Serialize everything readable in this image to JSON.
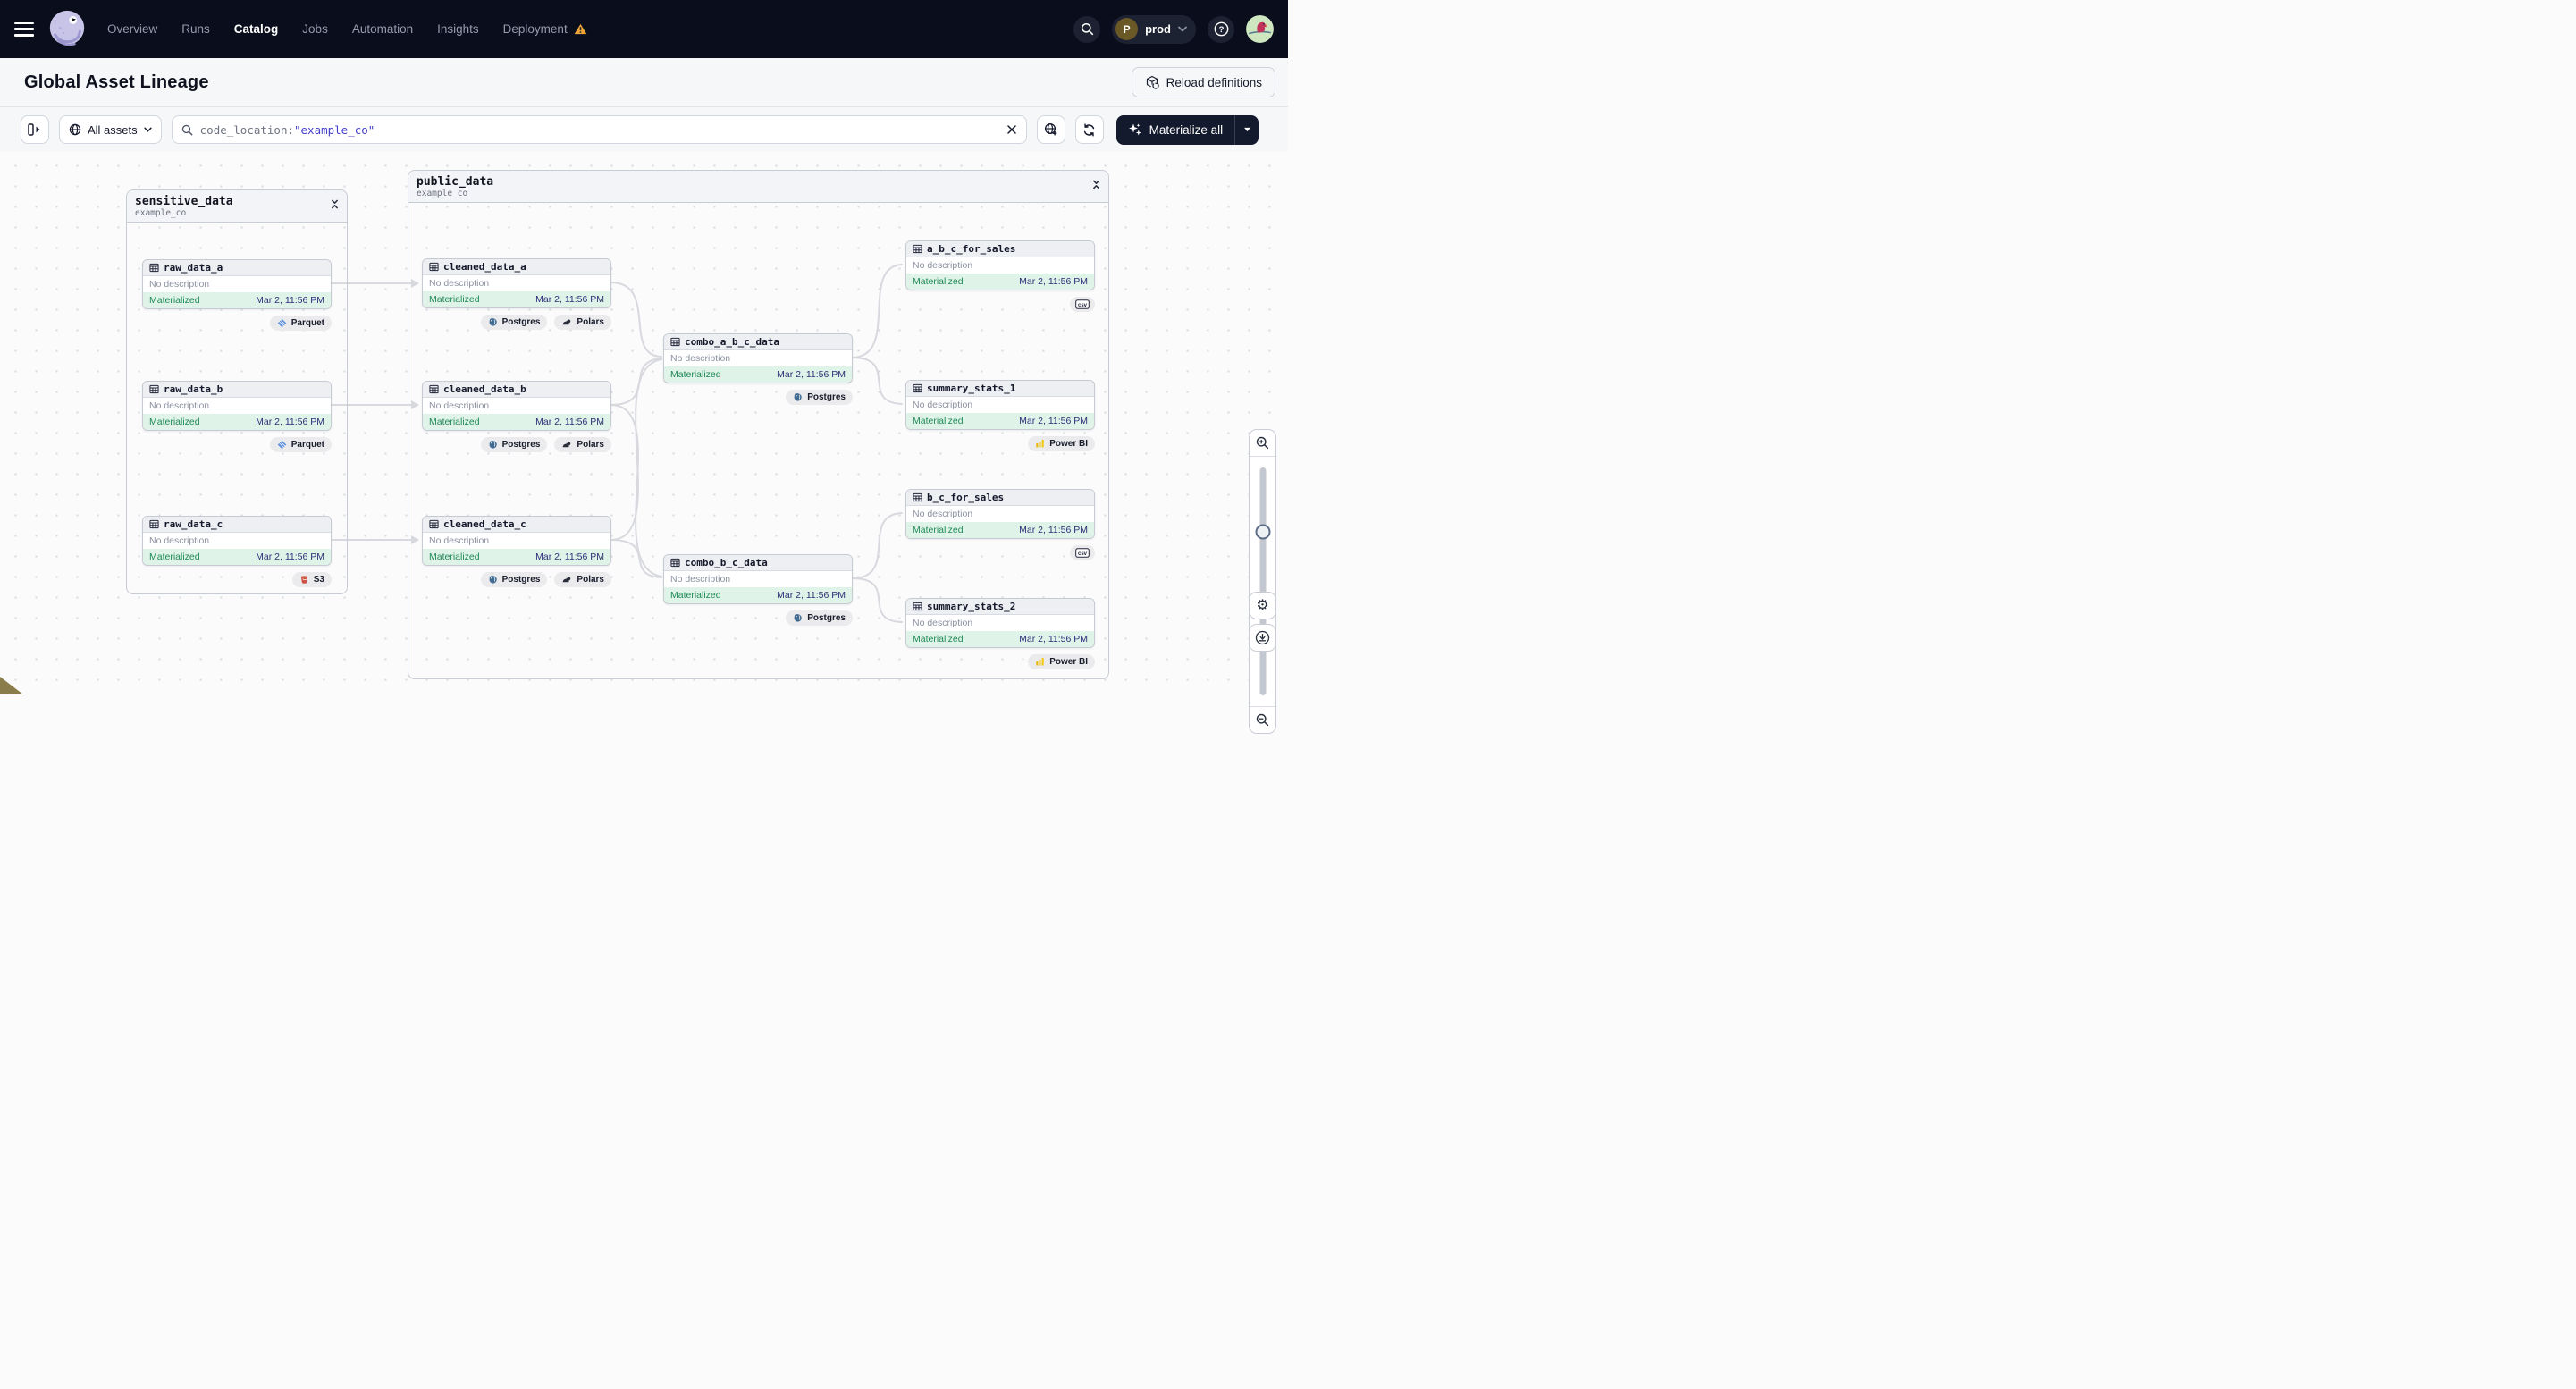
{
  "colors": {
    "nav_bg": "#0a0d1c",
    "materialize_bg": "#141a2e",
    "status_green": "#1f8a56",
    "timestamp_indigo": "#2e2f78",
    "search_value_indigo": "#4640c9",
    "warning_orange": "#eda338",
    "edge_gray": "#d8d9de"
  },
  "nav": {
    "items": [
      {
        "label": "Overview"
      },
      {
        "label": "Runs"
      },
      {
        "label": "Catalog",
        "active": true
      },
      {
        "label": "Jobs"
      },
      {
        "label": "Automation"
      },
      {
        "label": "Insights"
      },
      {
        "label": "Deployment",
        "warning": true
      }
    ],
    "user": {
      "initial": "P",
      "deployment": "prod"
    }
  },
  "header": {
    "title": "Global Asset Lineage",
    "reload_button": "Reload definitions"
  },
  "toolbar": {
    "filter_label": "All assets",
    "search_prefix": "code_location:",
    "search_value": "\"example_co\"",
    "materialize_label": "Materialize all"
  },
  "canvas": {
    "groups": [
      {
        "title": "sensitive_data",
        "subtitle": "example_co"
      },
      {
        "title": "public_data",
        "subtitle": "example_co"
      }
    ],
    "nodes": [
      {
        "name": "raw_data_a",
        "description": "No description",
        "status": "Materialized",
        "time": "Mar 2, 11:56 PM",
        "badges": [
          {
            "label": "Parquet",
            "icon": "parquet-icon"
          }
        ]
      },
      {
        "name": "raw_data_b",
        "description": "No description",
        "status": "Materialized",
        "time": "Mar 2, 11:56 PM",
        "badges": [
          {
            "label": "Parquet",
            "icon": "parquet-icon"
          }
        ]
      },
      {
        "name": "raw_data_c",
        "description": "No description",
        "status": "Materialized",
        "time": "Mar 2, 11:56 PM",
        "badges": [
          {
            "label": "S3",
            "icon": "s3-icon"
          }
        ]
      },
      {
        "name": "cleaned_data_a",
        "description": "No description",
        "status": "Materialized",
        "time": "Mar 2, 11:56 PM",
        "badges": [
          {
            "label": "Postgres",
            "icon": "postgres-icon"
          },
          {
            "label": "Polars",
            "icon": "polars-icon"
          }
        ]
      },
      {
        "name": "cleaned_data_b",
        "description": "No description",
        "status": "Materialized",
        "time": "Mar 2, 11:56 PM",
        "badges": [
          {
            "label": "Postgres",
            "icon": "postgres-icon"
          },
          {
            "label": "Polars",
            "icon": "polars-icon"
          }
        ]
      },
      {
        "name": "cleaned_data_c",
        "description": "No description",
        "status": "Materialized",
        "time": "Mar 2, 11:56 PM",
        "badges": [
          {
            "label": "Postgres",
            "icon": "postgres-icon"
          },
          {
            "label": "Polars",
            "icon": "polars-icon"
          }
        ]
      },
      {
        "name": "combo_a_b_c_data",
        "description": "No description",
        "status": "Materialized",
        "time": "Mar 2, 11:56 PM",
        "badges": [
          {
            "label": "Postgres",
            "icon": "postgres-icon"
          }
        ]
      },
      {
        "name": "combo_b_c_data",
        "description": "No description",
        "status": "Materialized",
        "time": "Mar 2, 11:56 PM",
        "badges": [
          {
            "label": "Postgres",
            "icon": "postgres-icon"
          }
        ]
      },
      {
        "name": "a_b_c_for_sales",
        "description": "No description",
        "status": "Materialized",
        "time": "Mar 2, 11:56 PM",
        "badges": [
          {
            "label": "csv",
            "icon": "csv-icon"
          }
        ]
      },
      {
        "name": "summary_stats_1",
        "description": "No description",
        "status": "Materialized",
        "time": "Mar 2, 11:56 PM",
        "badges": [
          {
            "label": "Power BI",
            "icon": "powerbi-icon"
          }
        ]
      },
      {
        "name": "b_c_for_sales",
        "description": "No description",
        "status": "Materialized",
        "time": "Mar 2, 11:56 PM",
        "badges": [
          {
            "label": "csv",
            "icon": "csv-icon"
          }
        ]
      },
      {
        "name": "summary_stats_2",
        "description": "No description",
        "status": "Materialized",
        "time": "Mar 2, 11:56 PM",
        "badges": [
          {
            "label": "Power BI",
            "icon": "powerbi-icon"
          }
        ]
      }
    ]
  }
}
